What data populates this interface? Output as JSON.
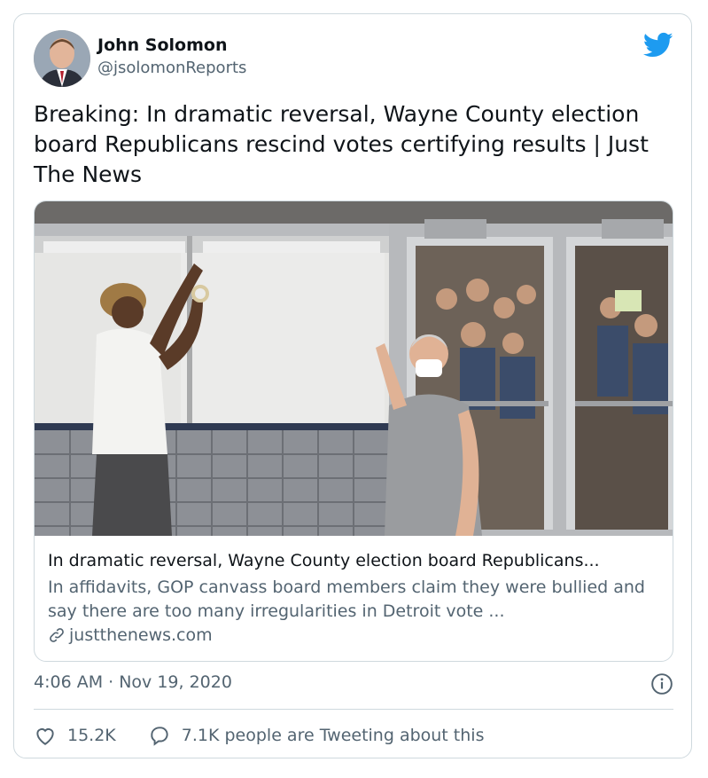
{
  "author": {
    "name": "John Solomon",
    "handle": "@jsolomonReports"
  },
  "tweet": {
    "text": "Breaking: In dramatic reversal, Wayne County election board Republicans rescind votes certifying results | Just The News"
  },
  "link_card": {
    "title": "In dramatic reversal, Wayne County election board Republicans...",
    "description": "In affidavits, GOP canvass board members claim they were bullied and say there are too many irregularities in Detroit vote ...",
    "domain": "justthenews.com"
  },
  "meta": {
    "timestamp": "4:06 AM · Nov 19, 2020"
  },
  "actions": {
    "likes": "15.2K",
    "retweets_text": "7.1K people are Tweeting about this"
  },
  "colors": {
    "brand_blue": "#1d9bf0",
    "text_primary": "#0f1419",
    "text_secondary": "#536471",
    "border": "#cfd9de"
  },
  "icons": [
    "twitter-bird-icon",
    "link-icon",
    "info-icon",
    "heart-icon",
    "reply-bubble-icon"
  ]
}
